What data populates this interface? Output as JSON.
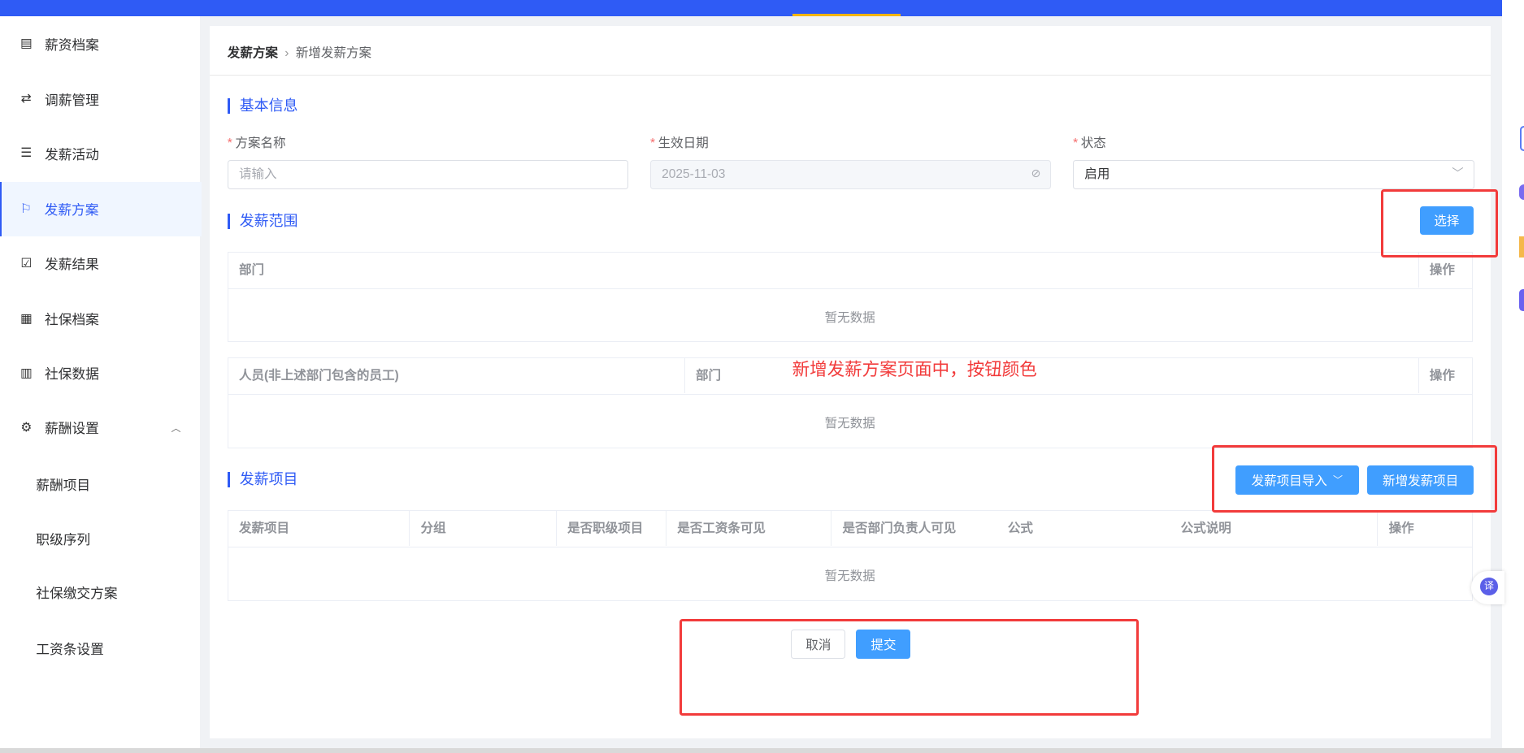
{
  "sidebar": {
    "items": [
      {
        "label": "薪资档案",
        "icon": "document-icon"
      },
      {
        "label": "调薪管理",
        "icon": "exchange-icon"
      },
      {
        "label": "发薪活动",
        "icon": "list-icon"
      },
      {
        "label": "发薪方案",
        "icon": "flag-icon",
        "active": true
      },
      {
        "label": "发薪结果",
        "icon": "clipboard-check-icon"
      },
      {
        "label": "社保档案",
        "icon": "grid-icon"
      },
      {
        "label": "社保数据",
        "icon": "bar-chart-icon"
      },
      {
        "label": "薪酬设置",
        "icon": "gear-icon",
        "expanded": true
      }
    ],
    "subitems": [
      "薪酬项目",
      "职级序列",
      "社保缴交方案",
      "工资条设置"
    ]
  },
  "breadcrumb": {
    "parent": "发薪方案",
    "current": "新增发薪方案"
  },
  "basic": {
    "title": "基本信息",
    "name_label": "方案名称",
    "name_placeholder": "请输入",
    "date_label": "生效日期",
    "date_value": "2025-11-03",
    "status_label": "状态",
    "status_value": "启用"
  },
  "scope": {
    "title": "发薪范围",
    "select_button": "选择",
    "dept_table": {
      "columns": [
        "部门",
        "操作"
      ],
      "empty": "暂无数据"
    },
    "people_table": {
      "columns": [
        "人员(非上述部门包含的员工)",
        "部门",
        "操作"
      ],
      "empty": "暂无数据"
    }
  },
  "items": {
    "title": "发薪项目",
    "import_button": "发薪项目导入",
    "add_button": "新增发薪项目",
    "table": {
      "columns": [
        "发薪项目",
        "分组",
        "是否职级项目",
        "是否工资条可见",
        "是否部门负责人可见",
        "公式",
        "公式说明",
        "操作"
      ],
      "empty": "暂无数据"
    }
  },
  "footer": {
    "cancel": "取消",
    "submit": "提交"
  },
  "annotation": "新增发薪方案页面中，按钮颜色",
  "colors": {
    "primary": "#409eff",
    "brand": "#2f5bf5",
    "annotation": "#f23b3b"
  }
}
